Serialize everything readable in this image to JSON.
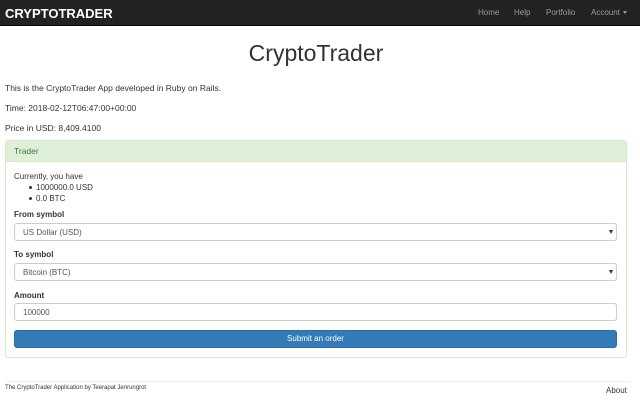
{
  "navbar": {
    "brand": "CRYPTOTRADER",
    "links": [
      "Home",
      "Help",
      "Portfolio"
    ],
    "account_label": "Account"
  },
  "page": {
    "title": "CryptoTrader",
    "intro": "This is the CryptoTrader App developed in Ruby on Rails.",
    "time": "Time: 2018-02-12T06:47:00+00:00",
    "price": "Price in USD: 8,409.4100"
  },
  "trader": {
    "heading": "Trader",
    "currently": "Currently, you have",
    "holdings": [
      "1000000.0 USD",
      "0.0 BTC"
    ],
    "from_label": "From symbol",
    "from_value": "US Dollar (USD)",
    "to_label": "To symbol",
    "to_value": "Bitcoin (BTC)",
    "amount_label": "Amount",
    "amount_value": "100000",
    "submit_label": "Submit an order"
  },
  "footer": {
    "credit": "The CryptoTrader Application by Teerapat Jenrungrot",
    "about": "About"
  },
  "colors": {
    "navbar_bg": "#222222",
    "panel_heading_bg": "#dff0d8",
    "panel_heading_text": "#3c763d",
    "primary": "#337ab7"
  }
}
